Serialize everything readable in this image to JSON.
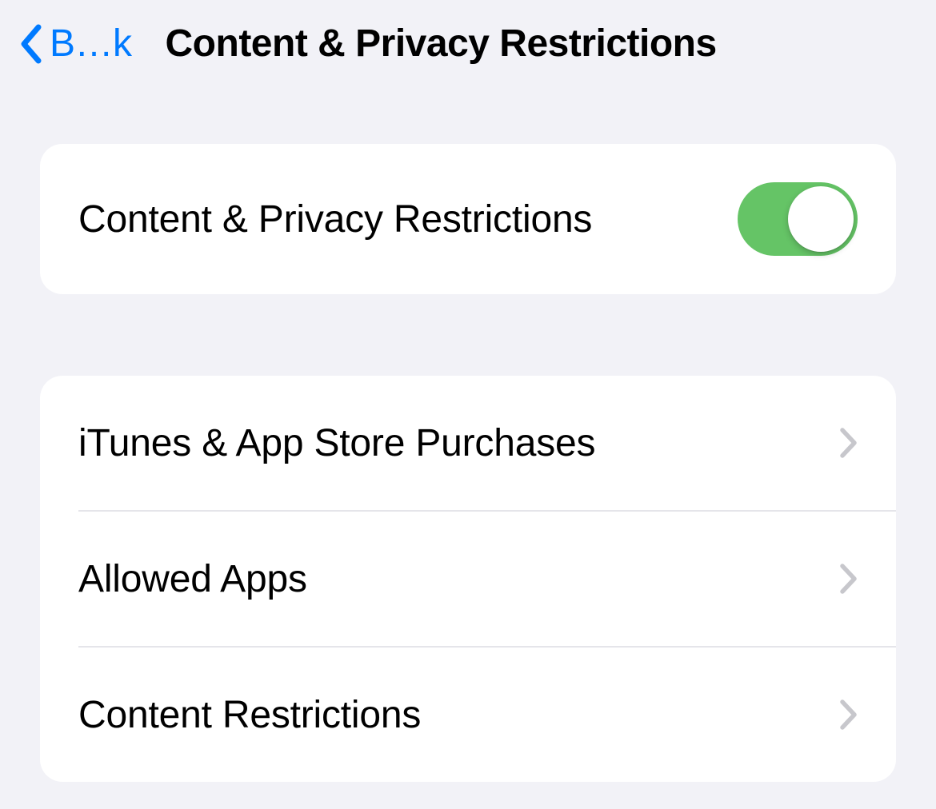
{
  "nav": {
    "back_label": "B…k",
    "title": "Content & Privacy Restrictions"
  },
  "main_toggle": {
    "label": "Content & Privacy Restrictions",
    "on": true
  },
  "links": [
    {
      "label": "iTunes & App Store Purchases"
    },
    {
      "label": "Allowed Apps"
    },
    {
      "label": "Content Restrictions"
    }
  ]
}
